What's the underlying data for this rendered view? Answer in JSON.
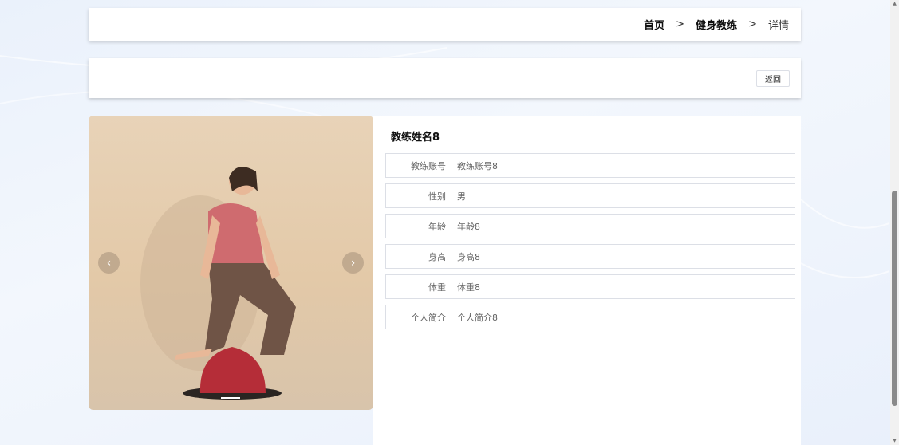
{
  "breadcrumb": {
    "home": "首页",
    "sep1": ">",
    "section": "健身教练",
    "sep2": ">",
    "current": "详情"
  },
  "actions": {
    "back_label": "返回"
  },
  "carousel": {
    "prev_icon": "‹",
    "next_icon": "›"
  },
  "detail": {
    "title": "教练姓名8",
    "fields": [
      {
        "label": "教练账号",
        "value": "教练账号8"
      },
      {
        "label": "性别",
        "value": "男"
      },
      {
        "label": "年龄",
        "value": "年龄8"
      },
      {
        "label": "身高",
        "value": "身高8"
      },
      {
        "label": "体重",
        "value": "体重8"
      },
      {
        "label": "个人简介",
        "value": "个人简介8"
      }
    ]
  }
}
